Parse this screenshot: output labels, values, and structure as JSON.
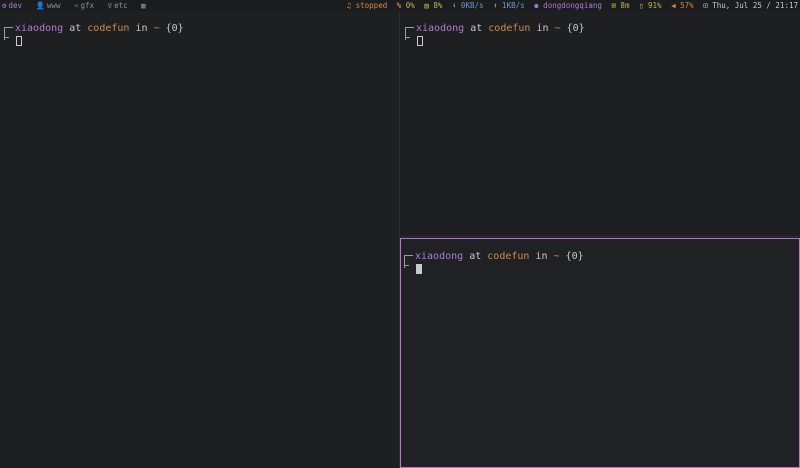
{
  "statusbar": {
    "workspaces": [
      {
        "icon": "⚙",
        "label": "dev",
        "active": true
      },
      {
        "icon": "👤",
        "label": "www",
        "active": false
      },
      {
        "icon": "♒",
        "label": "gfx",
        "active": false
      },
      {
        "icon": "☿",
        "label": "etc",
        "active": false
      },
      {
        "icon": "▦",
        "label": "",
        "active": false
      }
    ],
    "mpd": "♫ stopped",
    "cpu": "% 0%",
    "mem": "▤ 8%",
    "net_down": "⬇ 0KB/s",
    "net_up": "⬆ 1KB/s",
    "user": "⚉ dongdongqiang",
    "updates": "⊞ 8m",
    "battery": "▯ 91%",
    "volume": "◀ 57%",
    "clock": "⊡ Thu, Jul 25 / 21:17"
  },
  "prompt": {
    "user": "xiaodong",
    "at": "at",
    "host": "codefun",
    "in": "in",
    "dir": "~",
    "jobs": "{0}"
  }
}
